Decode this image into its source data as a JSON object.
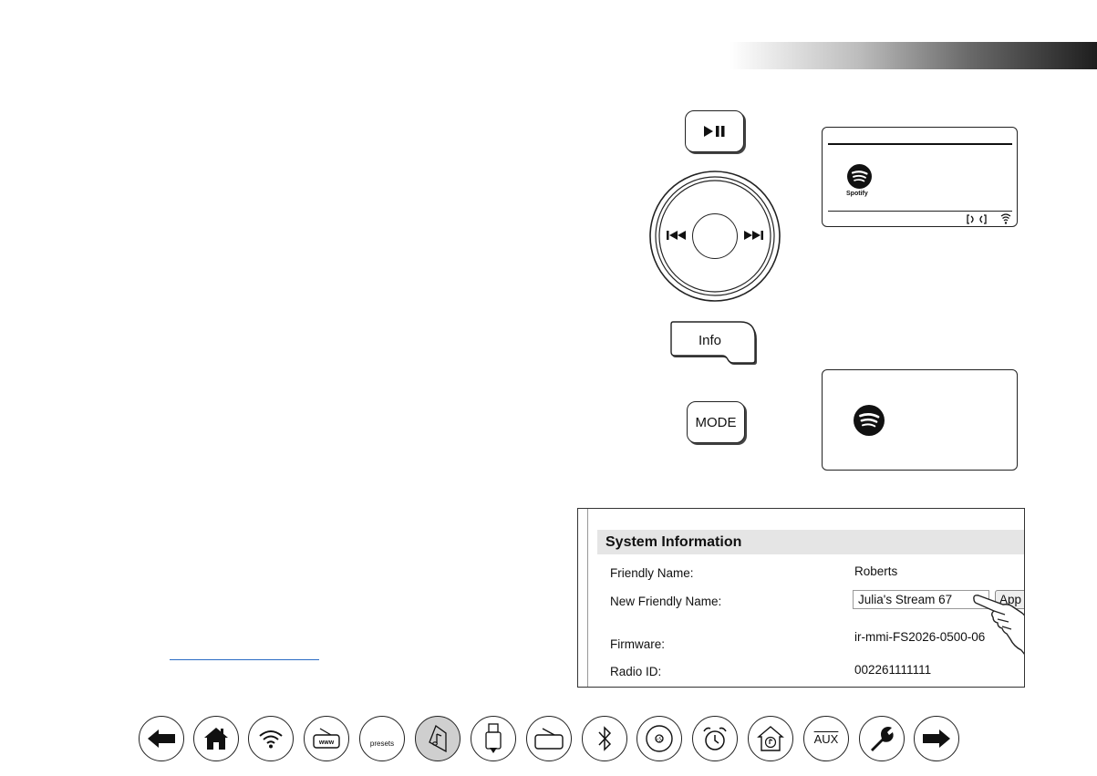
{
  "controls": {
    "info_label": "Info",
    "mode_label": "MODE"
  },
  "display_top": {
    "logo_text": "Spotify"
  },
  "system_info": {
    "title": "System Information",
    "rows": [
      {
        "label": "Friendly Name:",
        "value": "Roberts"
      },
      {
        "label": "New Friendly Name:",
        "value": "Julia's Stream 67"
      },
      {
        "label": "Firmware:",
        "value": "ir-mmi-FS2026-0500-06"
      },
      {
        "label": "Radio ID:",
        "value": "002261111111"
      }
    ],
    "apply_label": "App"
  },
  "nav": {
    "presets_label": "presets",
    "aux_label": "AUX",
    "items": [
      "back-icon",
      "home-icon",
      "wifi-icon",
      "internet-radio-icon",
      "presets-icon",
      "music-player-icon",
      "usb-icon",
      "radio-icon",
      "bluetooth-icon",
      "cd-icon",
      "alarm-icon",
      "home-music-icon",
      "aux-icon",
      "wrench-icon",
      "forward-icon"
    ]
  },
  "colors": {
    "link": "#2b6cc4",
    "active_nav": "#cfcfcf"
  }
}
